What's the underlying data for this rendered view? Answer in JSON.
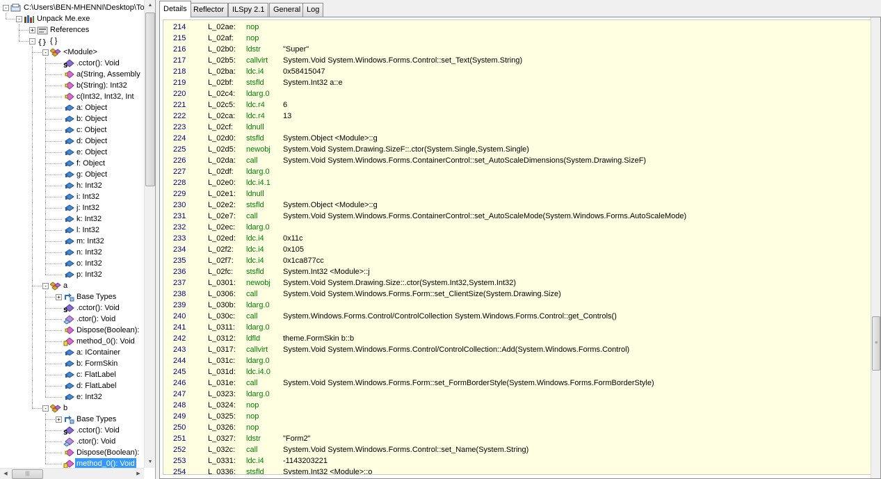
{
  "tree": {
    "nodes": [
      {
        "label": "C:\\Users\\BEN-MHENNI\\Desktop\\To",
        "depth": 0,
        "expander": "-",
        "icon": "folder-icon"
      },
      {
        "label": "Unpack Me.exe",
        "depth": 1,
        "expander": "-",
        "icon": "assembly-icon"
      },
      {
        "label": "References",
        "depth": 2,
        "expander": "+",
        "icon": "references-icon"
      },
      {
        "label": "{ }",
        "depth": 2,
        "expander": "-",
        "icon": "namespace-icon"
      },
      {
        "label": "<Module>",
        "depth": 3,
        "expander": "-",
        "icon": "class-icon"
      },
      {
        "label": ".cctor(): Void",
        "depth": 4,
        "icon": "static-method-icon"
      },
      {
        "label": "a(String, Assembly",
        "depth": 4,
        "icon": "method-icon"
      },
      {
        "label": "b(String): Int32",
        "depth": 4,
        "icon": "method-icon"
      },
      {
        "label": "c(Int32, Int32, Int",
        "depth": 4,
        "icon": "method-icon"
      },
      {
        "label": "a: Object",
        "depth": 4,
        "icon": "field-icon"
      },
      {
        "label": "b: Object",
        "depth": 4,
        "icon": "field-icon"
      },
      {
        "label": "c: Object",
        "depth": 4,
        "icon": "field-icon"
      },
      {
        "label": "d: Object",
        "depth": 4,
        "icon": "field-icon"
      },
      {
        "label": "e: Object",
        "depth": 4,
        "icon": "field-icon"
      },
      {
        "label": "f: Object",
        "depth": 4,
        "icon": "field-icon"
      },
      {
        "label": "g: Object",
        "depth": 4,
        "icon": "field-icon"
      },
      {
        "label": "h: Int32",
        "depth": 4,
        "icon": "field-icon"
      },
      {
        "label": "i: Int32",
        "depth": 4,
        "icon": "field-icon"
      },
      {
        "label": "j: Int32",
        "depth": 4,
        "icon": "field-icon"
      },
      {
        "label": "k: Int32",
        "depth": 4,
        "icon": "field-icon"
      },
      {
        "label": "l: Int32",
        "depth": 4,
        "icon": "field-icon"
      },
      {
        "label": "m: Int32",
        "depth": 4,
        "icon": "field-icon"
      },
      {
        "label": "n: Int32",
        "depth": 4,
        "icon": "field-icon"
      },
      {
        "label": "o: Int32",
        "depth": 4,
        "icon": "field-icon"
      },
      {
        "label": "p: Int32",
        "depth": 4,
        "icon": "field-icon"
      },
      {
        "label": "a",
        "depth": 3,
        "expander": "-",
        "icon": "class-icon"
      },
      {
        "label": "Base Types",
        "depth": 4,
        "expander": "+",
        "icon": "base-types-icon"
      },
      {
        "label": ".cctor(): Void",
        "depth": 4,
        "icon": "static-method-icon"
      },
      {
        "label": ".ctor(): Void",
        "depth": 4,
        "icon": "constructor-icon"
      },
      {
        "label": "Dispose(Boolean):",
        "depth": 4,
        "icon": "method-icon"
      },
      {
        "label": "method_0(): Void",
        "depth": 4,
        "icon": "private-method-icon"
      },
      {
        "label": "a: IContainer",
        "depth": 4,
        "icon": "field-icon"
      },
      {
        "label": "b: FormSkin",
        "depth": 4,
        "icon": "field-icon"
      },
      {
        "label": "c: FlatLabel",
        "depth": 4,
        "icon": "field-icon"
      },
      {
        "label": "d: FlatLabel",
        "depth": 4,
        "icon": "field-icon"
      },
      {
        "label": "e: Int32",
        "depth": 4,
        "icon": "field-icon"
      },
      {
        "label": "b",
        "depth": 3,
        "expander": "-",
        "icon": "class-icon"
      },
      {
        "label": "Base Types",
        "depth": 4,
        "expander": "+",
        "icon": "base-types-icon"
      },
      {
        "label": ".cctor(): Void",
        "depth": 4,
        "icon": "static-method-icon"
      },
      {
        "label": ".ctor(): Void",
        "depth": 4,
        "icon": "constructor-icon"
      },
      {
        "label": "Dispose(Boolean):",
        "depth": 4,
        "icon": "method-icon"
      },
      {
        "label": "method_0(): Void",
        "depth": 4,
        "icon": "private-method-icon",
        "selected": true
      }
    ]
  },
  "tabs": [
    {
      "label": "Details",
      "active": true
    },
    {
      "label": "Reflector"
    },
    {
      "label": "ILSpy 2.1"
    },
    {
      "label": "General"
    },
    {
      "label": "Log"
    }
  ],
  "code": {
    "rows": [
      {
        "num": "214",
        "label": "L_02ae:",
        "op": "nop",
        "arg": ""
      },
      {
        "num": "215",
        "label": "L_02af:",
        "op": "nop",
        "arg": ""
      },
      {
        "num": "216",
        "label": "L_02b0:",
        "op": "ldstr",
        "arg": "\"Super\""
      },
      {
        "num": "217",
        "label": "L_02b5:",
        "op": "callvirt",
        "arg": "System.Void System.Windows.Forms.Control::set_Text(System.String)"
      },
      {
        "num": "218",
        "label": "L_02ba:",
        "op": "ldc.i4",
        "arg": "0x58415047"
      },
      {
        "num": "219",
        "label": "L_02bf:",
        "op": "stsfld",
        "arg": "System.Int32 a::e"
      },
      {
        "num": "220",
        "label": "L_02c4:",
        "op": "ldarg.0",
        "arg": ""
      },
      {
        "num": "221",
        "label": "L_02c5:",
        "op": "ldc.r4",
        "arg": "6"
      },
      {
        "num": "222",
        "label": "L_02ca:",
        "op": "ldc.r4",
        "arg": "13"
      },
      {
        "num": "223",
        "label": "L_02cf:",
        "op": "ldnull",
        "arg": ""
      },
      {
        "num": "224",
        "label": "L_02d0:",
        "op": "stsfld",
        "arg": "System.Object <Module>::g"
      },
      {
        "num": "225",
        "label": "L_02d5:",
        "op": "newobj",
        "arg": "System.Void System.Drawing.SizeF::.ctor(System.Single,System.Single)"
      },
      {
        "num": "226",
        "label": "L_02da:",
        "op": "call",
        "arg": "System.Void System.Windows.Forms.ContainerControl::set_AutoScaleDimensions(System.Drawing.SizeF)"
      },
      {
        "num": "227",
        "label": "L_02df:",
        "op": "ldarg.0",
        "arg": ""
      },
      {
        "num": "228",
        "label": "L_02e0:",
        "op": "ldc.i4.1",
        "arg": ""
      },
      {
        "num": "229",
        "label": "L_02e1:",
        "op": "ldnull",
        "arg": ""
      },
      {
        "num": "230",
        "label": "L_02e2:",
        "op": "stsfld",
        "arg": "System.Object <Module>::g"
      },
      {
        "num": "231",
        "label": "L_02e7:",
        "op": "call",
        "arg": "System.Void System.Windows.Forms.ContainerControl::set_AutoScaleMode(System.Windows.Forms.AutoScaleMode)"
      },
      {
        "num": "232",
        "label": "L_02ec:",
        "op": "ldarg.0",
        "arg": ""
      },
      {
        "num": "233",
        "label": "L_02ed:",
        "op": "ldc.i4",
        "arg": "0x11c"
      },
      {
        "num": "234",
        "label": "L_02f2:",
        "op": "ldc.i4",
        "arg": "0x105"
      },
      {
        "num": "235",
        "label": "L_02f7:",
        "op": "ldc.i4",
        "arg": "0x1ca877cc"
      },
      {
        "num": "236",
        "label": "L_02fc:",
        "op": "stsfld",
        "arg": "System.Int32 <Module>::j"
      },
      {
        "num": "237",
        "label": "L_0301:",
        "op": "newobj",
        "arg": "System.Void System.Drawing.Size::.ctor(System.Int32,System.Int32)"
      },
      {
        "num": "238",
        "label": "L_0306:",
        "op": "call",
        "arg": "System.Void System.Windows.Forms.Form::set_ClientSize(System.Drawing.Size)"
      },
      {
        "num": "239",
        "label": "L_030b:",
        "op": "ldarg.0",
        "arg": ""
      },
      {
        "num": "240",
        "label": "L_030c:",
        "op": "call",
        "arg": "System.Windows.Forms.Control/ControlCollection System.Windows.Forms.Control::get_Controls()"
      },
      {
        "num": "241",
        "label": "L_0311:",
        "op": "ldarg.0",
        "arg": ""
      },
      {
        "num": "242",
        "label": "L_0312:",
        "op": "ldfld",
        "arg": "theme.FormSkin b::b"
      },
      {
        "num": "243",
        "label": "L_0317:",
        "op": "callvirt",
        "arg": "System.Void System.Windows.Forms.Control/ControlCollection::Add(System.Windows.Forms.Control)"
      },
      {
        "num": "244",
        "label": "L_031c:",
        "op": "ldarg.0",
        "arg": ""
      },
      {
        "num": "245",
        "label": "L_031d:",
        "op": "ldc.i4.0",
        "arg": ""
      },
      {
        "num": "246",
        "label": "L_031e:",
        "op": "call",
        "arg": "System.Void System.Windows.Forms.Form::set_FormBorderStyle(System.Windows.Forms.FormBorderStyle)"
      },
      {
        "num": "247",
        "label": "L_0323:",
        "op": "ldarg.0",
        "arg": ""
      },
      {
        "num": "248",
        "label": "L_0324:",
        "op": "nop",
        "arg": ""
      },
      {
        "num": "249",
        "label": "L_0325:",
        "op": "nop",
        "arg": ""
      },
      {
        "num": "250",
        "label": "L_0326:",
        "op": "nop",
        "arg": ""
      },
      {
        "num": "251",
        "label": "L_0327:",
        "op": "ldstr",
        "arg": "\"Form2\""
      },
      {
        "num": "252",
        "label": "L_032c:",
        "op": "call",
        "arg": "System.Void System.Windows.Forms.Control::set_Name(System.String)"
      },
      {
        "num": "253",
        "label": "L_0331:",
        "op": "ldc.i4",
        "arg": "-1143203221"
      },
      {
        "num": "254",
        "label": "L_0336:",
        "op": "stsfld",
        "arg": "System.Int32 <Module>::o"
      }
    ]
  },
  "colors": {
    "opcode": "#008000",
    "line_number": "#000080",
    "code_background": "#ffffe1",
    "selection": "#3399ff"
  }
}
